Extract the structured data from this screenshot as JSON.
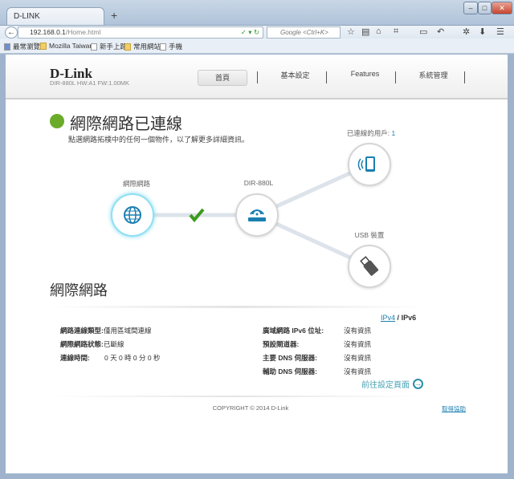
{
  "browser": {
    "tab_title": "D-LINK",
    "url_host": "192.168.0.1",
    "url_path": "/Home.html",
    "search_placeholder": "Google <Ctrl+K>",
    "bookmarks": [
      "最常瀏覽",
      "Mozilla Taiwan",
      "新手上路",
      "常用網站",
      "手機"
    ]
  },
  "header": {
    "logo": "D-Link",
    "model": "DIR-880L   HW:A1   FW:1.00MK",
    "nav": [
      "首頁",
      "基本設定",
      "Features",
      "系統管理"
    ]
  },
  "status": {
    "title": "網際網路已連線",
    "hint": "點選網路拓樸中的任何一個物件，以了解更多詳細資訊。",
    "color": "#6aab2a"
  },
  "topology": {
    "internet_label": "網際網路",
    "router_label": "DIR-880L",
    "clients_label": "已連線的用戶:",
    "clients_count": "1",
    "usb_label": "USB 裝置"
  },
  "section": {
    "title": "網際網路",
    "ipv4": "IPv4",
    "slash": "/",
    "ipv6": "IPv6",
    "left": [
      {
        "k": "網路連線類型:",
        "v": "僅用區域間連線"
      },
      {
        "k": "網際網路狀態:",
        "v": "已斷線"
      },
      {
        "k": "連線時間:",
        "v": "0 天 0 時 0 分 0 秒"
      }
    ],
    "right": [
      {
        "k": "廣域網路 IPv6 位址:",
        "v": "沒有資訊"
      },
      {
        "k": "預設閘道器:",
        "v": "沒有資訊"
      },
      {
        "k": "主要 DNS 伺服器:",
        "v": "沒有資訊"
      },
      {
        "k": "輔助 DNS 伺服器:",
        "v": "沒有資訊"
      }
    ],
    "goto": "前往設定頁面"
  },
  "footer": {
    "copyright": "COPYRIGHT © 2014 D-Link",
    "help": "取得協助"
  }
}
